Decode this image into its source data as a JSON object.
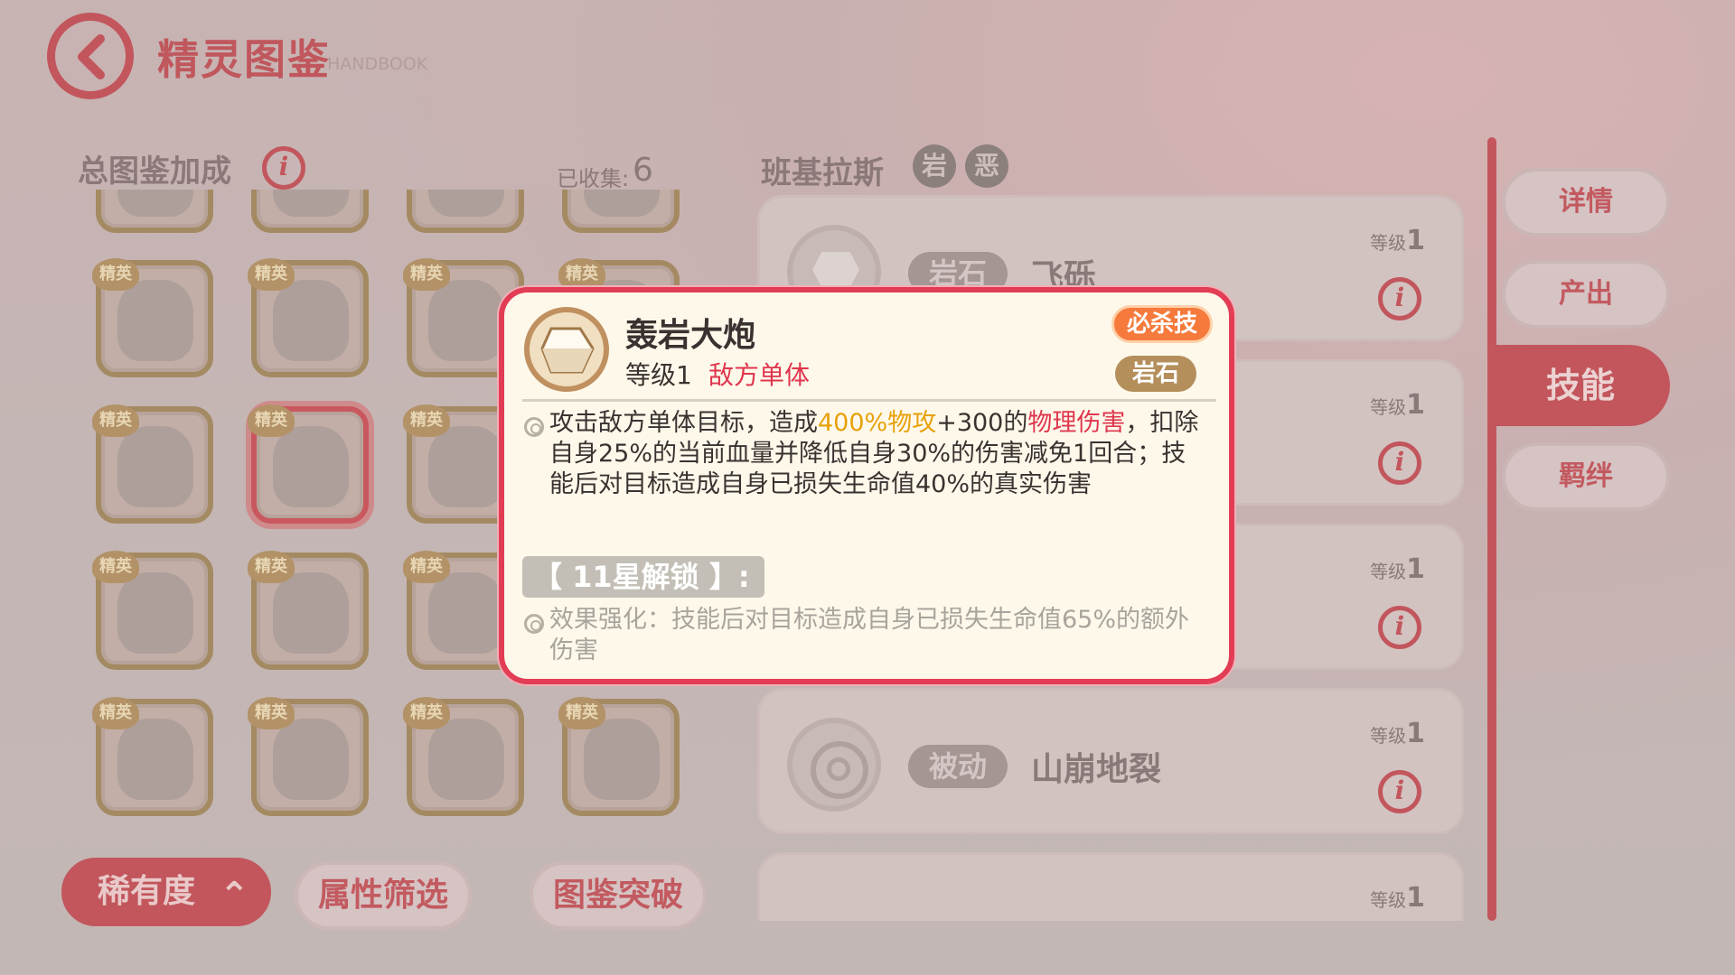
{
  "header": {
    "title": "精灵图鉴",
    "subtitle": "HANDBOOK"
  },
  "left_panel": {
    "bonus_label": "总图鉴加成",
    "info_icon": "i",
    "collected_label": "已收集:",
    "collected_count": "6",
    "elite_badge": "精英"
  },
  "filters": {
    "rarity": "稀有度",
    "rarity_chevron": "⌃",
    "attribute": "属性筛选",
    "breakthrough": "图鉴突破"
  },
  "pokemon": {
    "name": "班基拉斯",
    "types": [
      "岩",
      "恶"
    ]
  },
  "skills": [
    {
      "category": "岩石",
      "name": "飞砾",
      "level_label": "等级",
      "level": "1",
      "icon": "rock-icon"
    },
    {
      "category": "",
      "name": "",
      "level_label": "等级",
      "level": "1",
      "icon": ""
    },
    {
      "category": "",
      "name": "",
      "level_label": "等级",
      "level": "1",
      "icon": ""
    },
    {
      "category": "被动",
      "name": "山崩地裂",
      "level_label": "等级",
      "level": "1",
      "icon": "pokeball-icon"
    },
    {
      "category": "",
      "name": "",
      "level_label": "等级",
      "level": "1",
      "icon": "pokeball-icon"
    }
  ],
  "tabs": [
    "详情",
    "产出",
    "技能",
    "羁绊"
  ],
  "active_tab": "技能",
  "popup": {
    "skill_name": "轰岩大炮",
    "level": "等级1",
    "target": "敌方单体",
    "ultimate_tag": "必杀技",
    "element_tag": "岩石",
    "desc_1": "攻击敌方单体目标，造成",
    "desc_hl1": "400%物攻",
    "desc_2": "+300的",
    "desc_hl2": "物理伤害",
    "desc_3": "，扣除自身25%的当前血量并降低自身30%的伤害减免1回合；技能后对目标造成自身已损失生命值40%的真实伤害",
    "unlock_label": "【 11星解锁 】:",
    "extra_desc": "效果强化：技能后对目标造成自身已损失生命值65%的额外伤害"
  },
  "colors": {
    "accent": "#c2565c",
    "popup_border": "#e23d55",
    "highlight_yellow": "#e8a10a",
    "highlight_red": "#e0364e",
    "ultimate": "#f57a3c"
  }
}
